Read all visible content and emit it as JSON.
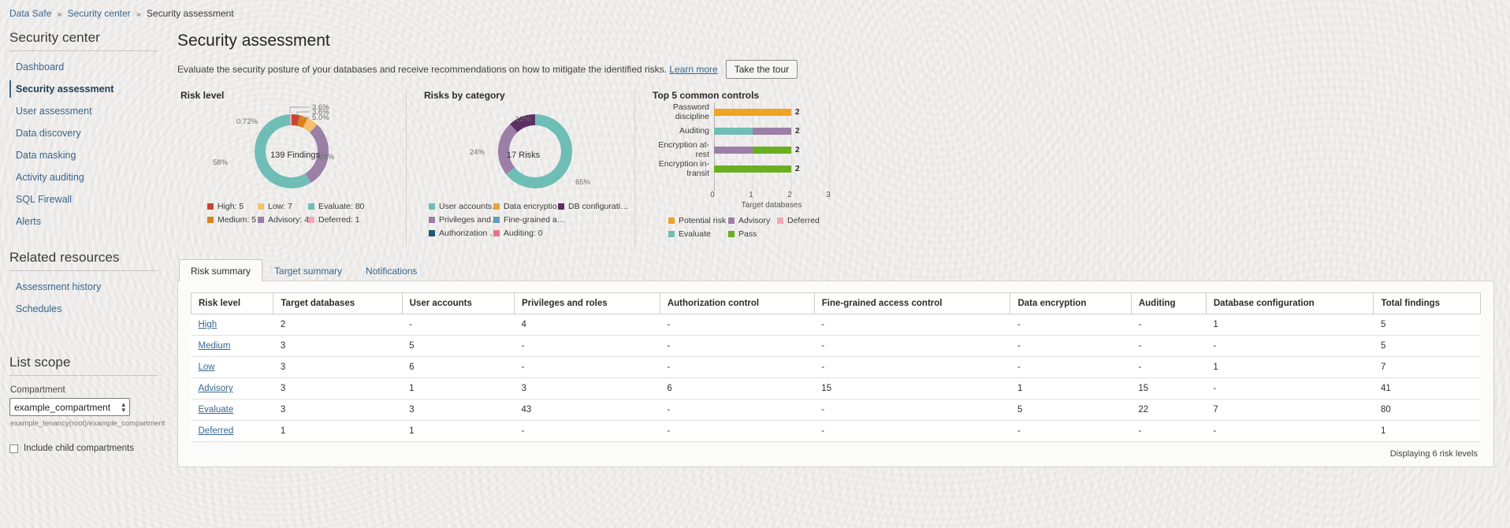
{
  "breadcrumb": {
    "items": [
      "Data Safe",
      "Security center",
      "Security assessment"
    ],
    "separator": "»"
  },
  "sidebar": {
    "heading": "Security center",
    "items": [
      {
        "label": "Dashboard",
        "active": false
      },
      {
        "label": "Security assessment",
        "active": true
      },
      {
        "label": "User assessment",
        "active": false
      },
      {
        "label": "Data discovery",
        "active": false
      },
      {
        "label": "Data masking",
        "active": false
      },
      {
        "label": "Activity auditing",
        "active": false
      },
      {
        "label": "SQL Firewall",
        "active": false
      },
      {
        "label": "Alerts",
        "active": false
      }
    ],
    "related_heading": "Related resources",
    "related_items": [
      {
        "label": "Assessment history"
      },
      {
        "label": "Schedules"
      }
    ],
    "scope_heading": "List scope",
    "compartment_label": "Compartment",
    "compartment_value": "example_compartment",
    "compartment_path": "example_tenancy(root)/example_compartment",
    "include_children_label": "Include child compartments",
    "include_children_checked": false
  },
  "header": {
    "title": "Security assessment",
    "subtitle": "Evaluate the security posture of your databases and receive recommendations on how to mitigate the identified risks.",
    "learn_more": "Learn more",
    "tour_button": "Take the tour"
  },
  "chart_data": [
    {
      "type": "pie",
      "title": "Risk level",
      "center_label": "139 Findings",
      "total": 139,
      "slice_label_suffix": "%",
      "slices": [
        {
          "name": "High",
          "count": 5,
          "percent": 3.6,
          "percent_label": "3.6%",
          "color": "#c74634"
        },
        {
          "name": "Medium",
          "count": 5,
          "percent": 3.6,
          "percent_label": "3.6%",
          "color": "#d9831f"
        },
        {
          "name": "Low",
          "count": 7,
          "percent": 5.0,
          "percent_label": "5.0%",
          "color": "#f5c16c"
        },
        {
          "name": "Advisory",
          "count": 41,
          "percent": 29.0,
          "percent_label": "29%",
          "color": "#9b7fa6"
        },
        {
          "name": "Evaluate",
          "count": 80,
          "percent": 58.0,
          "percent_label": "58%",
          "color": "#6ebeb5"
        },
        {
          "name": "Deferred",
          "count": 1,
          "percent": 0.72,
          "percent_label": "0.72%",
          "color": "#f4a9b8"
        }
      ],
      "legend": [
        {
          "label": "High: 5",
          "color": "#c74634"
        },
        {
          "label": "Low: 7",
          "color": "#f5c16c"
        },
        {
          "label": "Evaluate: 80",
          "color": "#6ebeb5"
        },
        {
          "label": "Medium: 5",
          "color": "#d9831f"
        },
        {
          "label": "Advisory: 41",
          "color": "#9b7fa6"
        },
        {
          "label": "Deferred: 1",
          "color": "#f4a9b8"
        }
      ]
    },
    {
      "type": "pie",
      "title": "Risks by category",
      "center_label": "17 Risks",
      "total": 17,
      "slices": [
        {
          "name": "User accounts",
          "percent": 65.0,
          "percent_label": "65%",
          "color": "#6ebeb5"
        },
        {
          "name": "Privileges and roles",
          "percent": 24.0,
          "percent_label": "24%",
          "color": "#9b7fa6"
        },
        {
          "name": "DB configuration",
          "percent": 12.0,
          "percent_label": "12%",
          "color": "#5c2f63"
        }
      ],
      "legend": [
        {
          "label": "User accounts…",
          "color": "#6ebeb5"
        },
        {
          "label": "Data encryptio…",
          "color": "#e8a33d"
        },
        {
          "label": "DB configurati…",
          "color": "#5c2f63"
        },
        {
          "label": "Privileges and…",
          "color": "#9b7fa6"
        },
        {
          "label": "Fine-grained a…",
          "color": "#5e9fb8"
        },
        {
          "label": "Authorization …",
          "color": "#1d5773"
        },
        {
          "label": "Auditing: 0",
          "color": "#e8748c"
        }
      ]
    },
    {
      "type": "bar",
      "orientation": "horizontal",
      "title": "Top 5 common controls",
      "xlabel": "Target databases",
      "ylabel": "",
      "xlim": [
        0,
        3
      ],
      "xticks": [
        "0",
        "1",
        "2",
        "3"
      ],
      "categories": [
        "Password discipline",
        "Auditing",
        "Encryption at-rest",
        "Encryption in-transit"
      ],
      "values": [
        2,
        2,
        2,
        2
      ],
      "value_labels": [
        "2",
        "2",
        "2",
        "2"
      ],
      "stacks": [
        [
          {
            "status": "Potential risk",
            "value": 2,
            "color": "#eda323"
          }
        ],
        [
          {
            "status": "Evaluate",
            "value": 1,
            "color": "#6ebeb5"
          },
          {
            "status": "Advisory",
            "value": 1,
            "color": "#9b7fa6"
          }
        ],
        [
          {
            "status": "Advisory",
            "value": 1,
            "color": "#9b7fa6"
          },
          {
            "status": "Pass",
            "value": 1,
            "color": "#6aaf22"
          }
        ],
        [
          {
            "status": "Pass",
            "value": 2,
            "color": "#6aaf22"
          }
        ]
      ],
      "legend": [
        {
          "label": "Potential risk",
          "color": "#eda323"
        },
        {
          "label": "Advisory",
          "color": "#9b7fa6"
        },
        {
          "label": "Deferred",
          "color": "#f4a9b8"
        },
        {
          "label": "Evaluate",
          "color": "#6ebeb5"
        },
        {
          "label": "Pass",
          "color": "#6aaf22"
        }
      ]
    }
  ],
  "tabs": [
    {
      "label": "Risk summary",
      "selected": true
    },
    {
      "label": "Target summary",
      "selected": false
    },
    {
      "label": "Notifications",
      "selected": false
    }
  ],
  "table": {
    "columns": [
      "Risk level",
      "Target databases",
      "User accounts",
      "Privileges and roles",
      "Authorization control",
      "Fine-grained access control",
      "Data encryption",
      "Auditing",
      "Database configuration",
      "Total findings"
    ],
    "rows": [
      {
        "link": "High",
        "cells": [
          "2",
          "-",
          "4",
          "-",
          "-",
          "-",
          "-",
          "1",
          "5"
        ]
      },
      {
        "link": "Medium",
        "cells": [
          "3",
          "5",
          "-",
          "-",
          "-",
          "-",
          "-",
          "-",
          "5"
        ]
      },
      {
        "link": "Low",
        "cells": [
          "3",
          "6",
          "-",
          "-",
          "-",
          "-",
          "-",
          "1",
          "7"
        ]
      },
      {
        "link": "Advisory",
        "cells": [
          "3",
          "1",
          "3",
          "6",
          "15",
          "1",
          "15",
          "-",
          "41"
        ]
      },
      {
        "link": "Evaluate",
        "cells": [
          "3",
          "3",
          "43",
          "-",
          "-",
          "5",
          "22",
          "7",
          "80"
        ]
      },
      {
        "link": "Deferred",
        "cells": [
          "1",
          "1",
          "-",
          "-",
          "-",
          "-",
          "-",
          "-",
          "1"
        ]
      }
    ],
    "footer": "Displaying 6 risk levels"
  }
}
